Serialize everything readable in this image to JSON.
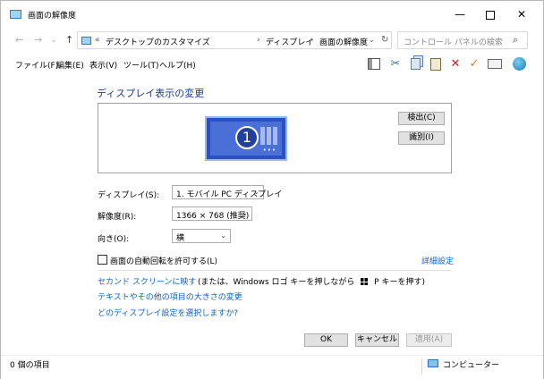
{
  "window": {
    "title": "画面の解像度",
    "controls": {
      "minimize": "—",
      "maximize": "",
      "close": "✕"
    }
  },
  "address_bar": {
    "overflow": "«",
    "crumbs": [
      "デスクトップのカスタマイズ",
      "ディスプレイ",
      "画面の解像度"
    ],
    "separator": "›"
  },
  "search": {
    "placeholder": "コントロール パネルの検索"
  },
  "menu": [
    "ファイル(F)",
    "編集(E)",
    "表示(V)",
    "ツール(T)",
    "ヘルプ(H)"
  ],
  "toolbar_icons": [
    "pane-icon",
    "cut-icon",
    "copy-icon",
    "paste-icon",
    "delete-icon",
    "check-icon",
    "keyboard-icon",
    "globe-icon"
  ],
  "heading": "ディスプレイ表示の変更",
  "preview": {
    "monitor_number": "1",
    "detect_label": "検出(C)",
    "identify_label": "識別(I)"
  },
  "settings": {
    "display": {
      "label": "ディスプレイ(S):",
      "value": "1. モバイル PC ディスプレイ"
    },
    "resolution": {
      "label": "解像度(R):",
      "value": "1366 × 768 (推奨)"
    },
    "orientation": {
      "label": "向き(O):",
      "value": "横"
    }
  },
  "auto_rotate": {
    "label": "画面の自動回転を許可する(L)",
    "checked": false
  },
  "advanced_link": "詳細設定",
  "links": {
    "second_screen": "セカンド スクリーンに映す",
    "second_screen_note_a": "(または、Windows ロゴ キーを押しながら",
    "second_screen_note_b": "P キーを押す)",
    "text_size": "テキストやその他の項目の大きさの変更",
    "which_settings": "どのディスプレイ設定を選択しますか?"
  },
  "buttons": {
    "ok": "OK",
    "cancel": "キャンセル",
    "apply": "適用(A)"
  },
  "status": {
    "items": "0 個の項目",
    "location": "コンピューター"
  },
  "colors": {
    "heading": "#1e3a8a",
    "link": "#1060c8",
    "monitor": "#2a50c8"
  }
}
